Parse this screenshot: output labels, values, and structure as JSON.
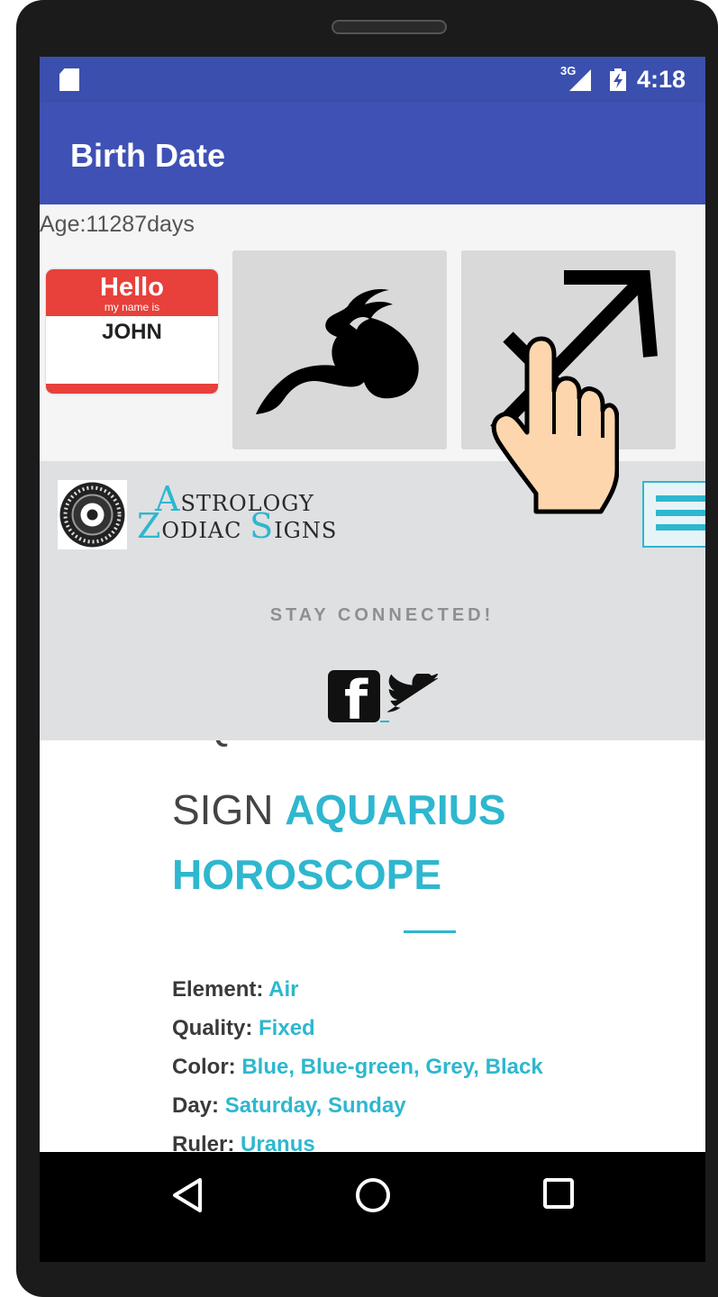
{
  "status_bar": {
    "network": "3G",
    "time": "4:18",
    "icons": [
      "sd-card-icon",
      "signal-icon",
      "battery-icon"
    ]
  },
  "app_bar": {
    "title": "Birth Date"
  },
  "age": {
    "text": "Age:11287days"
  },
  "name_tag": {
    "hello": "Hello",
    "subtitle": "my name is",
    "name": "JOHN"
  },
  "zodiac_tiles": [
    "taurus-icon",
    "sagittarius-icon"
  ],
  "web_header": {
    "logo_line1": {
      "cap": "A",
      "rest": "STROLOGY"
    },
    "logo_line2": {
      "cap1": "Z",
      "rest1": "ODIAC ",
      "cap2": "S",
      "rest2": "IGNS"
    },
    "stay_connected": "STAY CONNECTED!",
    "social_icons": [
      "facebook-icon",
      "twitter-icon"
    ]
  },
  "article": {
    "title_cut": "AQUARIUS ZODIAC",
    "title_sign": "SIGN ",
    "title_accent_1": "AQUARIUS",
    "title_accent_2": "HOROSCOPE",
    "facts": [
      {
        "label": "Element:",
        "value": "Air"
      },
      {
        "label": "Quality:",
        "value": "Fixed"
      },
      {
        "label": "Color:",
        "value": "Blue, Blue-green, Grey, Black"
      },
      {
        "label": "Day:",
        "value": "Saturday, Sunday"
      },
      {
        "label": "Ruler:",
        "value": "Uranus"
      }
    ]
  },
  "nav_bar": {
    "icons": [
      "back-icon",
      "home-icon",
      "recents-icon"
    ]
  },
  "colors": {
    "status_bar": "#3a4fae",
    "app_bar": "#3f51b5",
    "accent": "#2eb7cf",
    "name_tag_red": "#e8403b"
  }
}
